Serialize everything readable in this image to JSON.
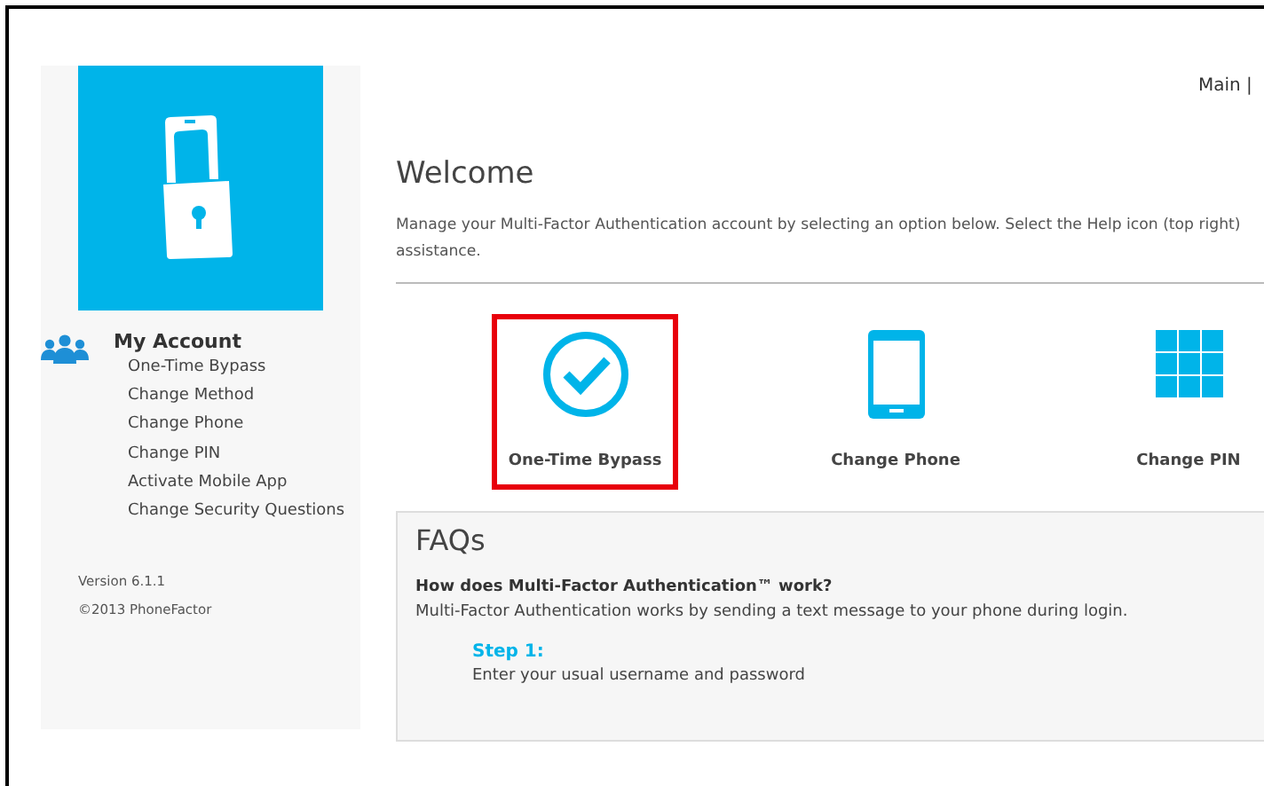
{
  "sidebar": {
    "section_title": "My Account",
    "items": [
      {
        "label": "One-Time Bypass"
      },
      {
        "label": "Change Method"
      },
      {
        "label": "Change Phone"
      },
      {
        "label": "Change PIN"
      },
      {
        "label": "Activate Mobile App"
      },
      {
        "label": "Change Security Questions"
      }
    ],
    "version": "Version 6.1.1",
    "copyright": "©2013 PhoneFactor"
  },
  "top_nav": "Main |",
  "welcome": {
    "title": "Welcome",
    "lines": [
      "Manage your Multi-Factor Authentication account by selecting an option below. Select the Help icon (top right)",
      "assistance."
    ]
  },
  "tiles": [
    {
      "kind": "check",
      "label": "One-Time Bypass",
      "selected": true
    },
    {
      "kind": "phone",
      "label": "Change Phone",
      "selected": false
    },
    {
      "kind": "grid",
      "label": "Change PIN",
      "selected": false
    }
  ],
  "faq": {
    "title": "FAQs",
    "question": "How does Multi-Factor Authentication™ work?",
    "answer": "Multi-Factor Authentication works by sending a text message to your phone during login.",
    "step_title": "Step 1:",
    "step_text": "Enter your usual username and password"
  }
}
